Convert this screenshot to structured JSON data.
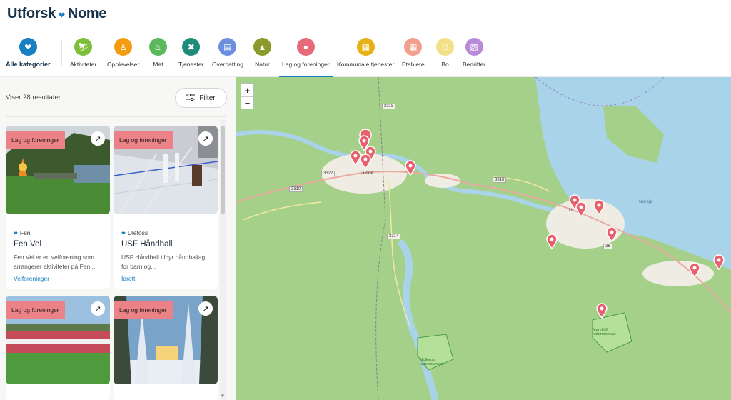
{
  "brand": {
    "name_a": "Utforsk",
    "name_b": "Nome"
  },
  "categories": [
    {
      "label": "Alle kategorier",
      "icon": "heart-icon",
      "color": "#1a7fc1"
    },
    {
      "label": "Aktiviteter",
      "icon": "activity-icon",
      "color": "#7dbf3a"
    },
    {
      "label": "Opplevelser",
      "icon": "hiker-icon",
      "color": "#f39c12"
    },
    {
      "label": "Mat",
      "icon": "food-icon",
      "color": "#5cb85c"
    },
    {
      "label": "Tjenester",
      "icon": "tools-icon",
      "color": "#1f8c7a"
    },
    {
      "label": "Overnatting",
      "icon": "bed-icon",
      "color": "#6c8fe0"
    },
    {
      "label": "Natur",
      "icon": "tree-icon",
      "color": "#8a9a2b"
    },
    {
      "label": "Lag og foreninger",
      "icon": "group-icon",
      "color": "#e66a7a"
    },
    {
      "label": "Kommunale tjenester",
      "icon": "building-icon",
      "color": "#e8b017"
    },
    {
      "label": "Etablere",
      "icon": "store-icon",
      "color": "#f2a08c"
    },
    {
      "label": "Bo",
      "icon": "home-icon",
      "color": "#f5e08a"
    },
    {
      "label": "Bedrifter",
      "icon": "factory-icon",
      "color": "#b88bd8"
    }
  ],
  "active_category": "Lag og foreninger",
  "results_text": "Viser 28 resultater",
  "filter_label": "Filter",
  "cards": [
    {
      "tag": "Lag og foreninger",
      "location": "Fen",
      "title": "Fen Vel",
      "description": "Fen Vel er en velforening som arrangerer aktiviteter på Fen...",
      "link": "Velforeninger"
    },
    {
      "tag": "Lag og foreninger",
      "location": "Ulefoss",
      "title": "USF Håndball",
      "description": "USF Håndball tilbyr håndballag for barn og...",
      "link": "Idrett"
    },
    {
      "tag": "Lag og foreninger"
    },
    {
      "tag": "Lag og foreninger"
    }
  ],
  "map": {
    "zoom_in": "+",
    "zoom_out": "−",
    "labels": {
      "lunde": "Lunde",
      "ulefoss": "Ul",
      "norsjo": "Norsjø",
      "naturreservat_1": "Mørkfjell naturreservat",
      "naturreservat_2": "Mollerup naturreservat"
    },
    "roads": [
      "3318",
      "3322",
      "3310",
      "3316",
      "3314",
      "36"
    ]
  }
}
